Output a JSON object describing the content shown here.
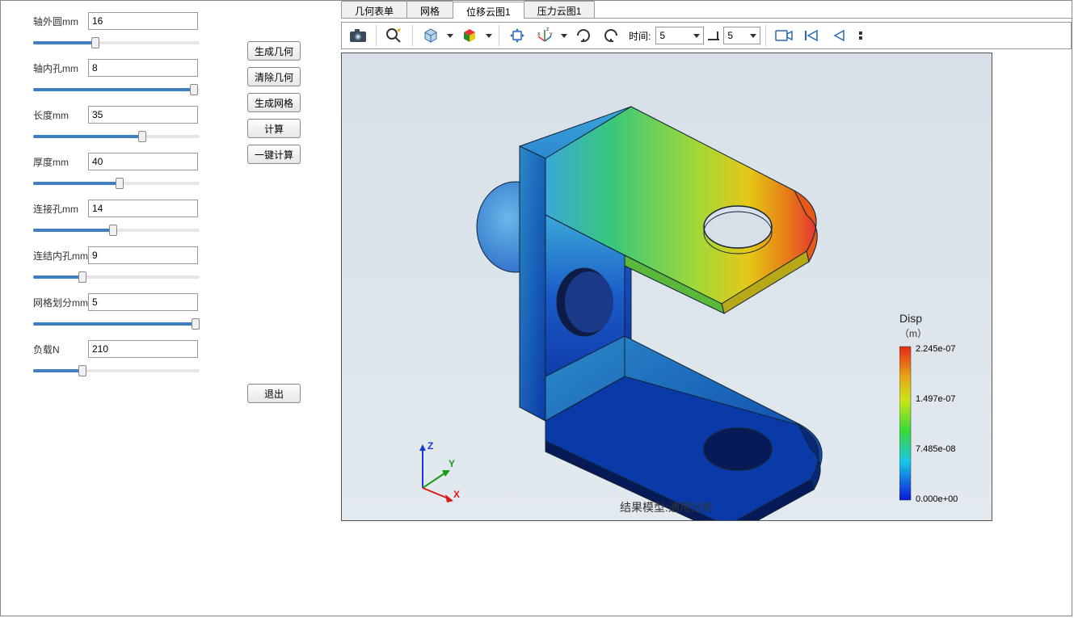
{
  "params": [
    {
      "label": "轴外圆mm",
      "value": "16",
      "fill": 76,
      "thumb": 72
    },
    {
      "label": "轴内孔mm",
      "value": "8",
      "fill": 198,
      "thumb": 194
    },
    {
      "label": "长度mm",
      "value": "35",
      "fill": 134,
      "thumb": 130
    },
    {
      "label": "厚度mm",
      "value": "40",
      "fill": 106,
      "thumb": 102
    },
    {
      "label": "连接孔mm",
      "value": "14",
      "fill": 98,
      "thumb": 94
    },
    {
      "label": "连结内孔mm",
      "value": "9",
      "fill": 60,
      "thumb": 56
    },
    {
      "label": "网格划分mm",
      "value": "5",
      "fill": 200,
      "thumb": 196
    },
    {
      "label": "负载N",
      "value": "210",
      "fill": 60,
      "thumb": 56
    }
  ],
  "actions": {
    "gen_geom": "生成几何",
    "clear_geom": "清除几何",
    "gen_mesh": "生成网格",
    "compute": "计算",
    "one_click": "一键计算",
    "exit": "退出"
  },
  "tabs": [
    "几何表单",
    "网格",
    "位移云图1",
    "压力云图1"
  ],
  "active_tab": 2,
  "toolbar": {
    "time_label": "时间:",
    "time_val": "5",
    "time_step": "5"
  },
  "viewport": {
    "title": "结果模型:通用分析"
  },
  "colorbar": {
    "title": "Disp",
    "unit": "（m）",
    "labels": [
      "2.245e-07",
      "1.497e-07",
      "7.485e-08",
      "0.000e+00"
    ]
  },
  "chart_data": {
    "type": "table",
    "title": "Displacement colorbar (m)",
    "rows": [
      {
        "position": "max",
        "value": 2.245e-07
      },
      {
        "position": "q3",
        "value": 1.497e-07
      },
      {
        "position": "q1",
        "value": 7.485e-08
      },
      {
        "position": "min",
        "value": 0.0
      }
    ]
  }
}
